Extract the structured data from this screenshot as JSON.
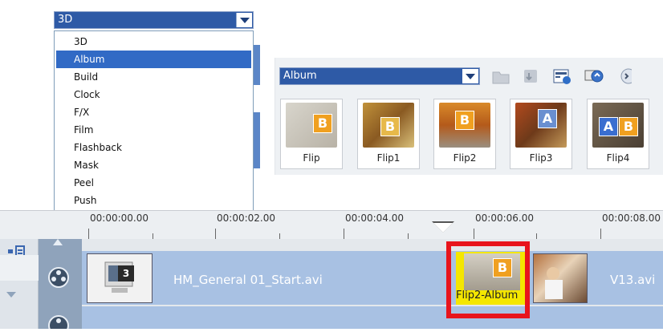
{
  "category_dropdown": {
    "selected": "3D",
    "items": [
      "3D",
      "Album",
      "Build",
      "Clock",
      "F/X",
      "Film",
      "Flashback",
      "Mask",
      "Peel",
      "Push"
    ],
    "highlighted": "Album"
  },
  "library": {
    "selected_folder": "Album",
    "toolbar_icons": [
      "folder-icon",
      "import-icon",
      "options-icon",
      "media-icon",
      "more-icon"
    ],
    "thumbnails": [
      {
        "label": "Flip"
      },
      {
        "label": "Flip1"
      },
      {
        "label": "Flip2"
      },
      {
        "label": "Flip3"
      },
      {
        "label": "Flip4"
      }
    ]
  },
  "ruler": {
    "labels": [
      "00:00:00.00",
      "00:00:02.00",
      "00:00:04.00",
      "00:00:06.00",
      "00:00:08.00"
    ]
  },
  "timeline": {
    "clip1_name": "HM_General 01_Start.avi",
    "clip1_thumb_badge": "3",
    "transition_label": "Flip2-Album",
    "transition_badge": "B",
    "clip3_name": "V13.avi"
  },
  "colors": {
    "selection_blue": "#316ac5",
    "track_blue": "#a8c1e3",
    "highlight_red": "#e8141c",
    "transition_yellow": "#f4e600"
  }
}
